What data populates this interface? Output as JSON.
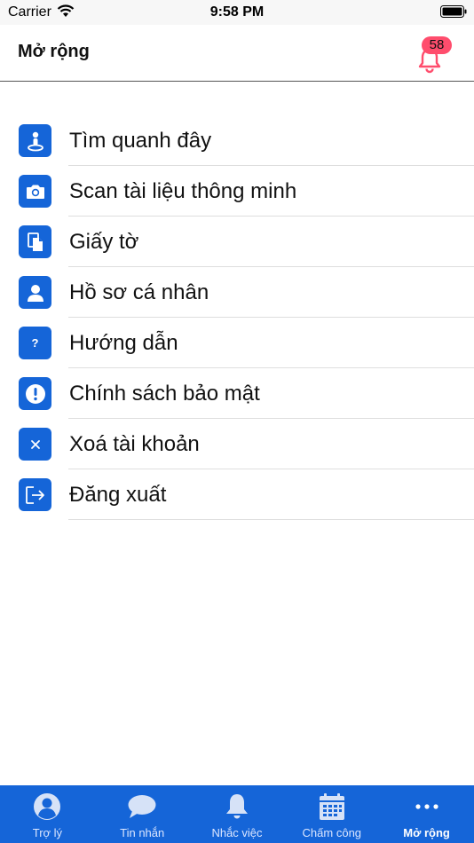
{
  "status_bar": {
    "carrier": "Carrier",
    "time": "9:58 PM"
  },
  "header": {
    "title": "Mở rộng",
    "notification_count": "58"
  },
  "menu": {
    "items": [
      {
        "label": "Tìm quanh đây",
        "icon": "location-person-icon"
      },
      {
        "label": "Scan tài liệu thông minh",
        "icon": "camera-icon"
      },
      {
        "label": "Giấy tờ",
        "icon": "document-icon"
      },
      {
        "label": "Hồ sơ cá nhân",
        "icon": "person-icon"
      },
      {
        "label": "Hướng dẫn",
        "icon": "question-icon"
      },
      {
        "label": "Chính sách bảo mật",
        "icon": "exclamation-icon"
      },
      {
        "label": "Xoá tài khoản",
        "icon": "close-icon"
      },
      {
        "label": "Đăng xuất",
        "icon": "logout-icon"
      }
    ]
  },
  "tabs": [
    {
      "label": "Trợ lý",
      "icon": "user-circle-icon",
      "active": false
    },
    {
      "label": "Tin nhắn",
      "icon": "chat-bubble-icon",
      "active": false
    },
    {
      "label": "Nhắc việc",
      "icon": "bell-icon",
      "active": false
    },
    {
      "label": "Chấm công",
      "icon": "calendar-icon",
      "active": false
    },
    {
      "label": "Mở rộng",
      "icon": "more-dots-icon",
      "active": true
    }
  ],
  "colors": {
    "primary": "#1565d8",
    "badge": "#ff4d6d",
    "bell": "#ff4d6d"
  }
}
